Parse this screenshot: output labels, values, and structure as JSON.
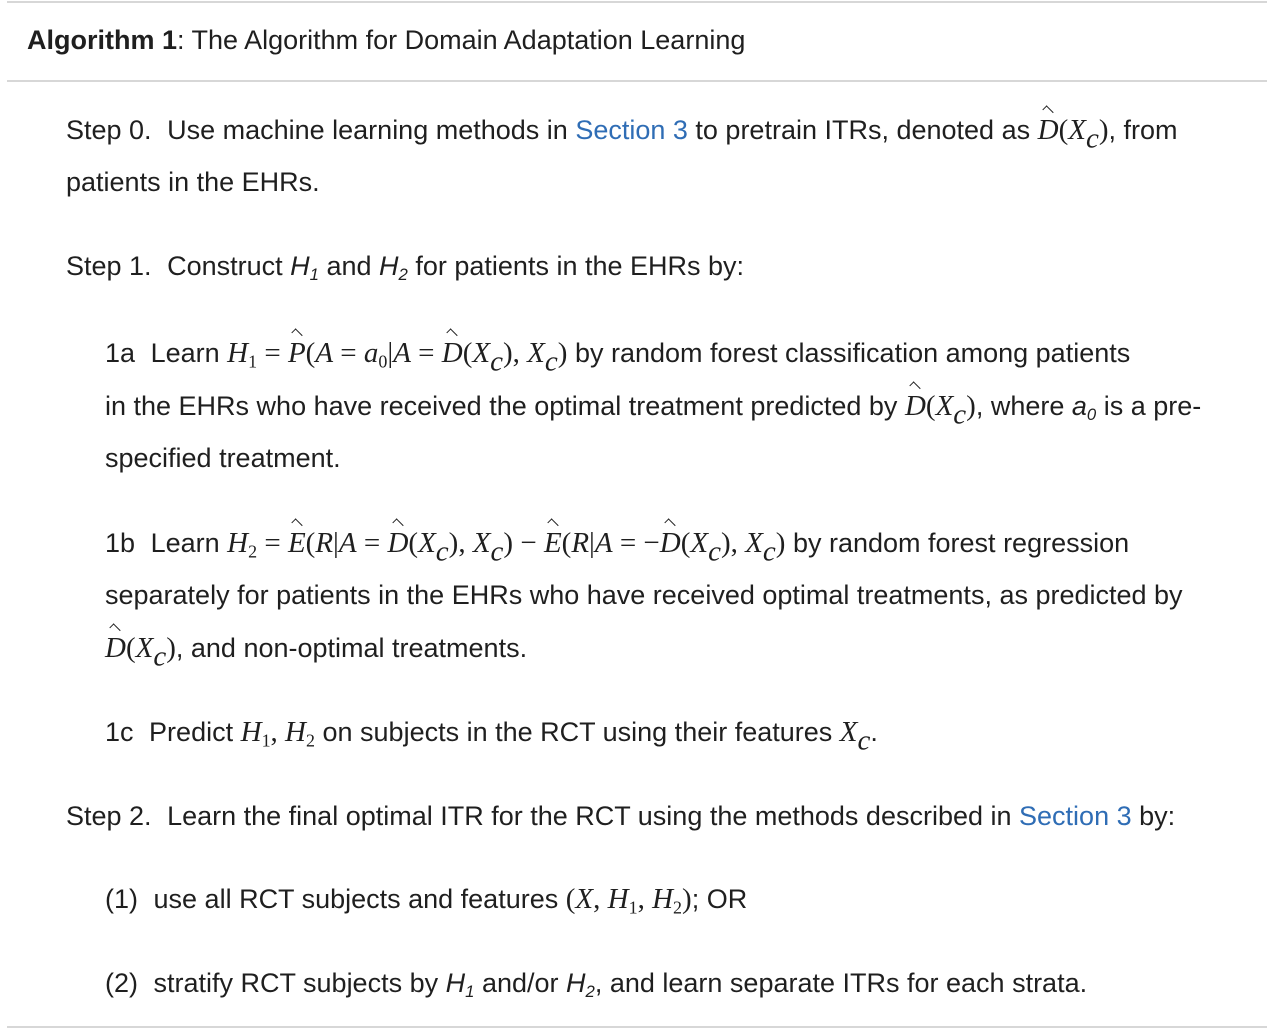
{
  "algorithm": {
    "label": "Algorithm 1",
    "title": ": The Algorithm for Domain Adaptation Learning"
  },
  "step0": {
    "label": "Step 0.",
    "text_a": "Use machine learning methods in",
    "link": "Section 3",
    "text_b": "to pretrain ITRs, denoted as",
    "text_c": ", from",
    "text_d": "patients in the EHRs."
  },
  "step1": {
    "label": "Step 1.",
    "text_a": "Construct",
    "text_b": "and",
    "text_c": "for patients in the EHRs by:"
  },
  "sub1a": {
    "label": "1a",
    "learn": "Learn",
    "text_a": "by random forest classification among patients",
    "text_b": "in the EHRs who have received the optimal treatment predicted by",
    "text_c": ", where",
    "text_d": "is a pre-",
    "text_e": "specified treatment."
  },
  "sub1b": {
    "label": "1b",
    "learn": "Learn",
    "text_a": "by random forest regression",
    "text_b": "separately for patients in the EHRs who have received optimal treatments, as predicted by",
    "text_c": ", and non-optimal treatments."
  },
  "sub1c": {
    "label": "1c",
    "predict": "Predict",
    "text_a": "on subjects in the RCT using their features",
    "text_b": "."
  },
  "step2": {
    "label": "Step 2.",
    "text_a": "Learn the final optimal ITR for the RCT using the methods described in",
    "link": "Section 3",
    "text_b": "by:"
  },
  "opt1": {
    "label": "(1)",
    "text_a": "use all RCT subjects and features",
    "text_b": "; OR"
  },
  "opt2": {
    "label": "(2)",
    "text_a": "stratify RCT subjects by",
    "text_b": "and/or",
    "text_c": ", and learn separate ITRs for each strata."
  },
  "colors": {
    "link": "#2f6db5",
    "rule": "#d7d7d7",
    "text": "#1f1f1f"
  }
}
